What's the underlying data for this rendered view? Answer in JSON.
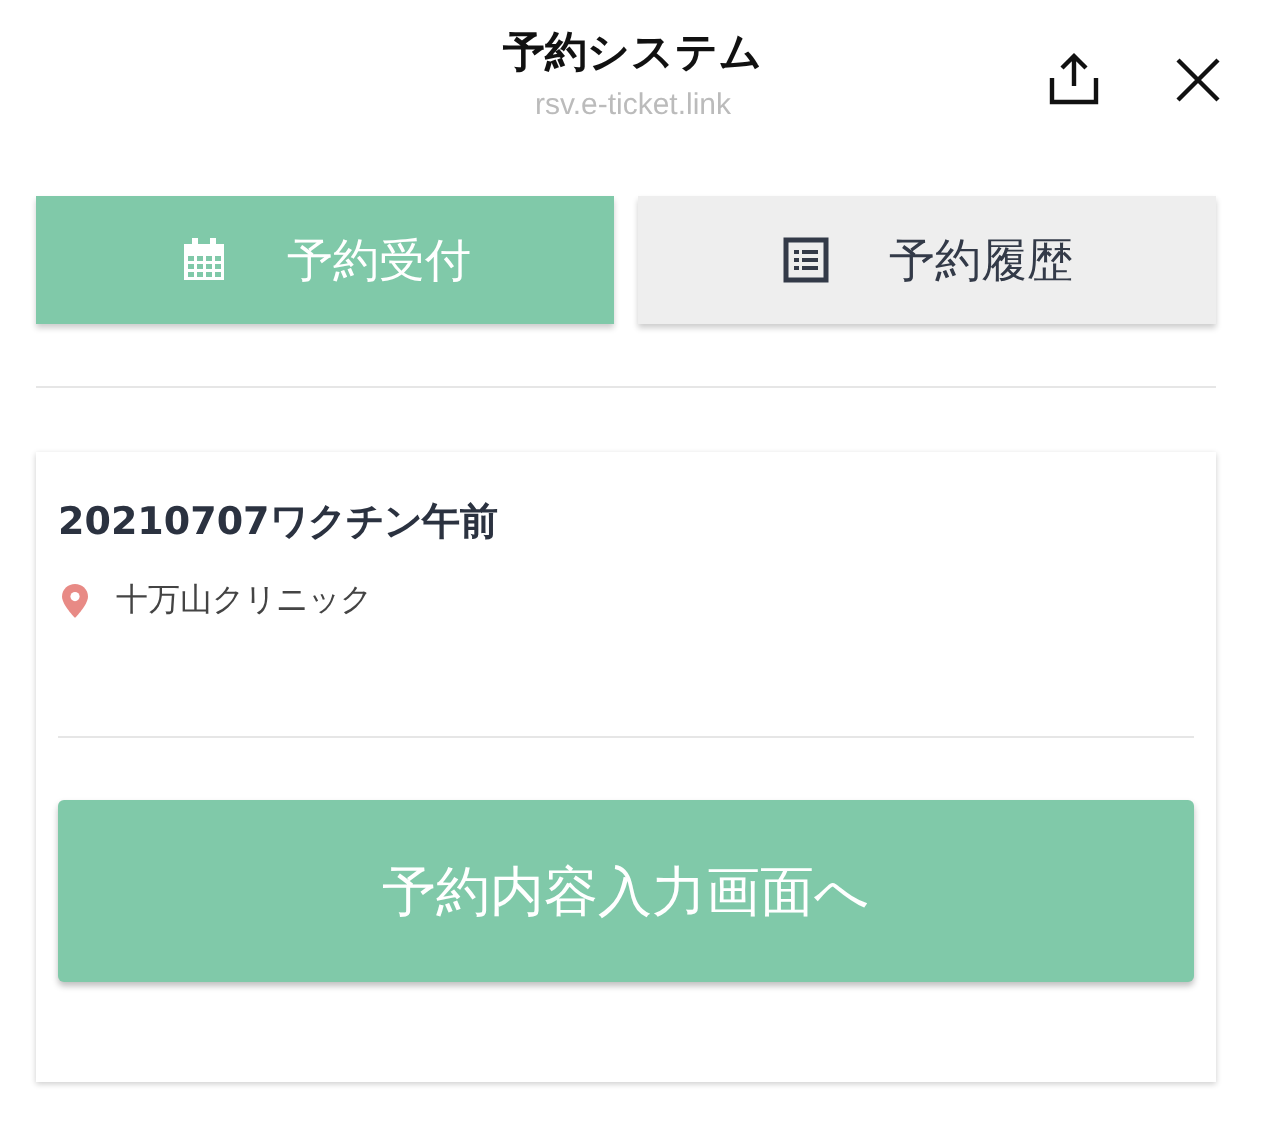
{
  "header": {
    "title": "予約システム",
    "url": "rsv.e-ticket.link"
  },
  "tabs": [
    {
      "label": "予約受付",
      "selected": true
    },
    {
      "label": "予約履歴",
      "selected": false
    }
  ],
  "event": {
    "title": "20210707ワクチン午前",
    "location": "十万山クリニック",
    "button": "予約内容入力画面へ"
  }
}
